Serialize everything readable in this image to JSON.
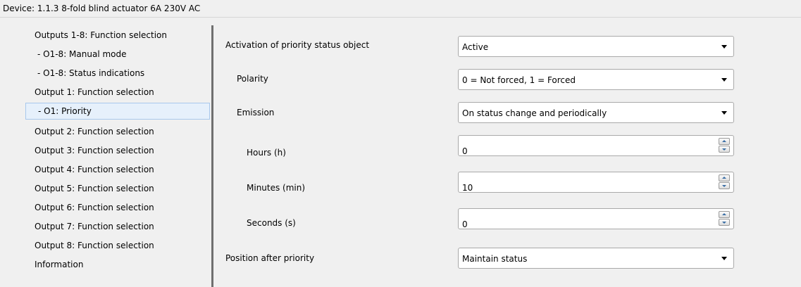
{
  "header": {
    "title": "Device: 1.1.3  8-fold blind  actuator 6A 230V AC"
  },
  "sidebar": {
    "items": [
      {
        "label": "Outputs 1-8: Function selection"
      },
      {
        "label": "- O1-8: Manual mode"
      },
      {
        "label": "- O1-8: Status indications"
      },
      {
        "label": "Output 1: Function selection"
      },
      {
        "label": "- O1: Priority",
        "selected": true
      },
      {
        "label": "Output 2: Function selection"
      },
      {
        "label": "Output 3: Function selection"
      },
      {
        "label": "Output 4: Function selection"
      },
      {
        "label": "Output 5: Function selection"
      },
      {
        "label": "Output 6: Function selection"
      },
      {
        "label": "Output 7: Function selection"
      },
      {
        "label": "Output 8: Function selection"
      },
      {
        "label": "Information"
      }
    ]
  },
  "params": {
    "activation": {
      "label": "Activation of priority status object",
      "value": "Active"
    },
    "polarity": {
      "label": "Polarity",
      "value": "0 = Not forced, 1 = Forced"
    },
    "emission": {
      "label": "Emission",
      "value": "On status change and periodically"
    },
    "hours": {
      "label": "Hours (h)",
      "value": "0"
    },
    "minutes": {
      "label": "Minutes (min)",
      "value": "10"
    },
    "seconds": {
      "label": "Seconds (s)",
      "value": "0"
    },
    "position": {
      "label": "Position after priority",
      "value": "Maintain status"
    }
  },
  "icons": {
    "dropdown": "chevron-down-icon",
    "spin_up": "spin-up-icon",
    "spin_down": "spin-down-icon"
  },
  "colors": {
    "selected_bg": "#e6f0fb",
    "selected_border": "#a8c8ec",
    "splitter": "#6f6f6f"
  }
}
